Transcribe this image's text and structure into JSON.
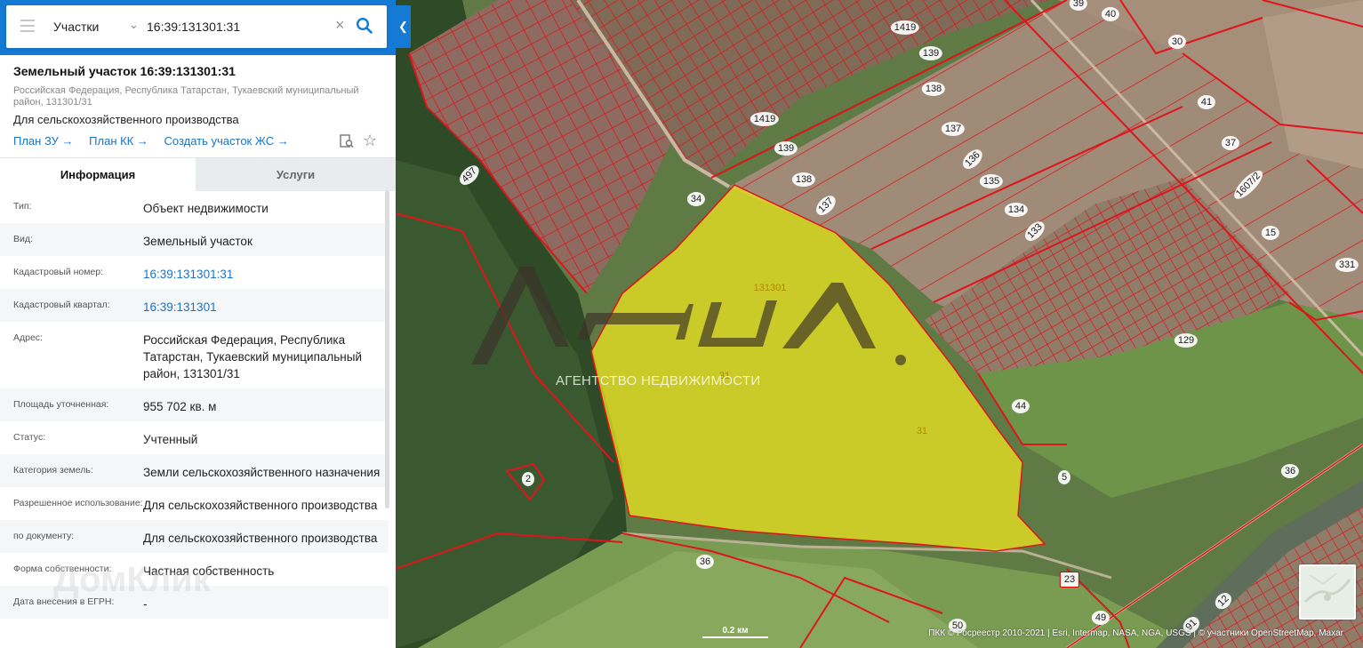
{
  "search": {
    "type_label": "Участки",
    "query": "16:39:131301:31"
  },
  "object": {
    "title": "Земельный участок 16:39:131301:31",
    "address_short": "Российская Федерация, Республика Татарстан, Тукаевский муниципальный район, 131301/31",
    "purpose": "Для сельскохозяйственного производства",
    "links": [
      "План ЗУ →",
      "План КК →",
      "Создать участок ЖС →"
    ]
  },
  "tabs": {
    "info": "Информация",
    "services": "Услуги"
  },
  "info_rows": [
    {
      "key": "Тип:",
      "value": "Объект недвижимости"
    },
    {
      "key": "Вид:",
      "value": "Земельный участок"
    },
    {
      "key": "Кадастровый номер:",
      "value": "16:39:131301:31"
    },
    {
      "key": "Кадастровый квартал:",
      "value": "16:39:131301"
    },
    {
      "key": "Адрес:",
      "value": "Российская Федерация, Республика Татарстан, Тукаевский муниципальный район, 131301/31"
    },
    {
      "key": "Площадь уточненная:",
      "value": "955 702 кв. м"
    },
    {
      "key": "Статус:",
      "value": "Учтенный"
    },
    {
      "key": "Категория земель:",
      "value": "Земли сельскохозяйственного назначения"
    },
    {
      "key": "Разрешенное использование:",
      "value": "Для сельскохозяйственного производства"
    },
    {
      "key": "по документу:",
      "value": "Для сельскохозяйственного производства"
    },
    {
      "key": "Форма собственности:",
      "value": "Частная собственность"
    },
    {
      "key": "Дата внесения в ЕГРН:",
      "value": "-"
    }
  ],
  "map": {
    "selected_quarter_label": "131301",
    "selected_plot_labels": [
      "31",
      "31"
    ],
    "plot_labels": [
      {
        "t": "39"
      },
      {
        "t": "40"
      },
      {
        "t": "1419"
      },
      {
        "t": "139"
      },
      {
        "t": "138"
      },
      {
        "t": "30"
      },
      {
        "t": "1419"
      },
      {
        "t": "137"
      },
      {
        "t": "41"
      },
      {
        "t": "139"
      },
      {
        "t": "136"
      },
      {
        "t": "37"
      },
      {
        "t": "497"
      },
      {
        "t": "138"
      },
      {
        "t": "135"
      },
      {
        "t": "34"
      },
      {
        "t": "137"
      },
      {
        "t": "134"
      },
      {
        "t": "1607/2"
      },
      {
        "t": "15"
      },
      {
        "t": "133"
      },
      {
        "t": "331"
      },
      {
        "t": "129"
      },
      {
        "t": "44"
      },
      {
        "t": "2"
      },
      {
        "t": "5"
      },
      {
        "t": "36"
      },
      {
        "t": "36"
      },
      {
        "t": "23"
      },
      {
        "t": "12"
      },
      {
        "t": "49"
      },
      {
        "t": "50"
      },
      {
        "t": "91"
      }
    ],
    "watermark_subtitle": "АГЕНТСТВО НЕДВИЖИМОСТИ",
    "domclick": "ДомКлик",
    "scale": "0.2 км",
    "attribution": "ПКК © Росреестр 2010-2021 | Esri, Intermap, NASA, NGA, USGS | © участники OpenStreetMap, Maxar"
  },
  "colors": {
    "accent": "#157ad4",
    "link": "#1a73c7",
    "parcel_border": "#e0141b",
    "selected_fill": "#e8e020"
  }
}
